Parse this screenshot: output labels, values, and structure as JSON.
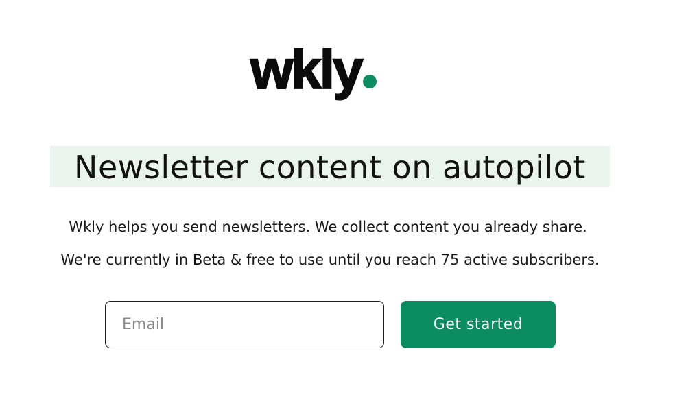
{
  "brand": {
    "name": "wkly",
    "dot_color": "#0b8c61"
  },
  "hero": {
    "headline": "Newsletter content on autopilot",
    "headline_highlight_color": "#e8f4ec"
  },
  "description": {
    "line1": "Wkly helps you send newsletters. We collect content you already share.",
    "line2_prefix": "We're currently in ",
    "line2_beta": "Beta",
    "line2_suffix": " & free to use until you reach 75 active subscribers."
  },
  "signup": {
    "email_placeholder": "Email",
    "email_value": "",
    "button_label": "Get started",
    "button_color": "#0b8c61"
  }
}
